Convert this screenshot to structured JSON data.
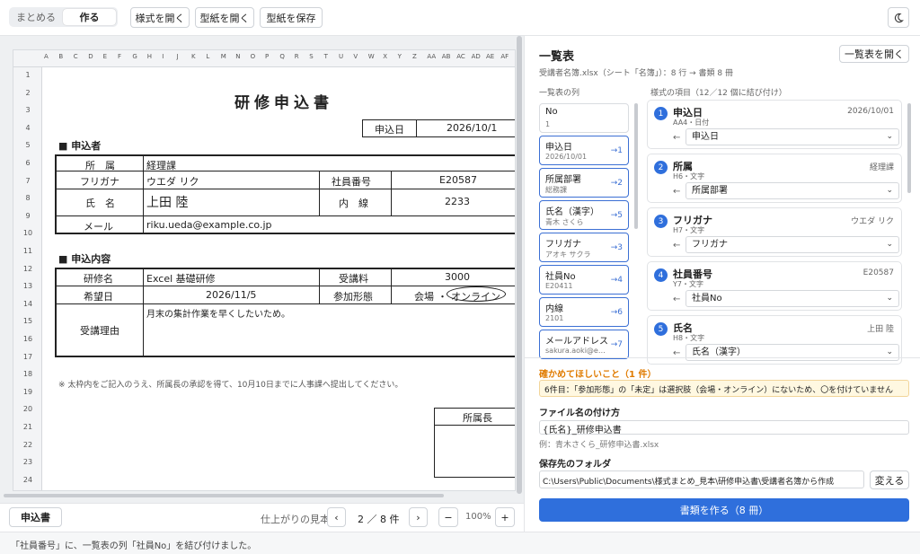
{
  "toolbar": {
    "mode_summary": "まとめる",
    "mode_make": "作る",
    "open_style": "様式を開く",
    "open_template": "型紙を開く",
    "save_template": "型紙を保存"
  },
  "sheet": {
    "columns": [
      "A",
      "B",
      "C",
      "D",
      "E",
      "F",
      "G",
      "H",
      "I",
      "J",
      "K",
      "L",
      "M",
      "N",
      "O",
      "P",
      "Q",
      "R",
      "S",
      "T",
      "U",
      "V",
      "W",
      "X",
      "Y",
      "Z",
      "AA",
      "AB",
      "AC",
      "AD",
      "AE",
      "AF"
    ],
    "rows": [
      "1",
      "2",
      "3",
      "4",
      "5",
      "6",
      "7",
      "8",
      "9",
      "10",
      "11",
      "12",
      "13",
      "14",
      "15",
      "16",
      "17",
      "18",
      "19",
      "20",
      "21",
      "22",
      "23",
      "24"
    ],
    "title": "研修申込書",
    "apply_date_label": "申込日",
    "apply_date": "2026/10/1",
    "section1": "■ 申込者",
    "dept_label": "所　属",
    "dept": "経理課",
    "kana_label": "フリガナ",
    "kana": "ウエダ リク",
    "empno_label": "社員番号",
    "empno": "E20587",
    "name_label": "氏　名",
    "name": "上田 陸",
    "ext_label": "内　線",
    "ext": "2233",
    "mail_label": "メール",
    "mail": "riku.ueda@example.co.jp",
    "section2": "■ 申込内容",
    "course_label": "研修名",
    "course": "Excel 基礎研修",
    "fee_label": "受講料",
    "fee": "3000",
    "wish_label": "希望日",
    "wish": "2026/11/5",
    "form_label": "参加形態",
    "form_venue": "会場",
    "form_sep": "・",
    "form_online": "オンライン",
    "reason_label": "受講理由",
    "reason": "月末の集計作業を早くしたいため。",
    "note": "※ 太枠内をご記入のうえ、所属長の承認を得て、10月10日までに人事課へ提出してください。",
    "boss_label": "所属長"
  },
  "footer": {
    "sheet_tab": "申込書",
    "preview_label": "仕上がりの見本",
    "page": "2 ／ 8 件",
    "zoom": "100%",
    "prev": "‹",
    "next": "›",
    "minus": "−",
    "plus": "+"
  },
  "panel": {
    "title": "一覧表",
    "open_list": "一覧表を開く",
    "source": "受講者名簿.xlsx（シート「名簿」）：8 行 → 書類 8 冊",
    "list_cols_label": "一覧表の列",
    "fields_label": "様式の項目（12／12 個に結び付け）",
    "list_items": [
      {
        "name": "No",
        "value": "1",
        "arrow": ""
      },
      {
        "name": "申込日",
        "value": "2026/10/01",
        "arrow": "→1"
      },
      {
        "name": "所属部署",
        "value": "総務課",
        "arrow": "→2"
      },
      {
        "name": "氏名（漢字）",
        "value": "青木 さくら",
        "arrow": "→5"
      },
      {
        "name": "フリガナ",
        "value": "アオキ サクラ",
        "arrow": "→3"
      },
      {
        "name": "社員No",
        "value": "E20411",
        "arrow": "→4"
      },
      {
        "name": "内線",
        "value": "2101",
        "arrow": "→6"
      },
      {
        "name": "メールアドレス",
        "value": "sakura.aoki@e…",
        "arrow": "→7"
      }
    ],
    "fields": [
      {
        "num": "1",
        "title": "申込日",
        "meta": "AA4・日付",
        "value": "2026/10/01",
        "arrow": "←",
        "select": "申込日"
      },
      {
        "num": "2",
        "title": "所属",
        "meta": "H6・文字",
        "value": "経理課",
        "arrow": "←",
        "select": "所属部署"
      },
      {
        "num": "3",
        "title": "フリガナ",
        "meta": "H7・文字",
        "value": "ウエダ リク",
        "arrow": "←",
        "select": "フリガナ"
      },
      {
        "num": "4",
        "title": "社員番号",
        "meta": "Y7・文字",
        "value": "E20587",
        "arrow": "←",
        "select": "社員No"
      },
      {
        "num": "5",
        "title": "氏名",
        "meta": "H8・文字",
        "value": "上田 陸",
        "arrow": "←",
        "select": "氏名（漢字）"
      }
    ],
    "warn_title": "確かめてほしいこと（1 件）",
    "warn_text": "6件目：「参加形態」の「未定」は選択肢（会場・オンライン）にないため、〇を付けていません",
    "filename_label": "ファイル名の付け方",
    "filename": "{氏名}_研修申込書",
    "filename_example": "例：青木さくら_研修申込書.xlsx",
    "folder_label": "保存先のフォルダ",
    "folder": "C:\\Users\\Public\\Documents\\様式まとめ_見本\\研修申込書\\受講者名簿から作成",
    "change": "変える",
    "make": "書類を作る（8 冊）"
  },
  "status": "「社員番号」に、一覧表の列「社員No」を結び付けました。",
  "colors": {
    "accent": "#2f6fdc",
    "warn": "#e07b00",
    "warn_bg": "#fff8e1"
  }
}
